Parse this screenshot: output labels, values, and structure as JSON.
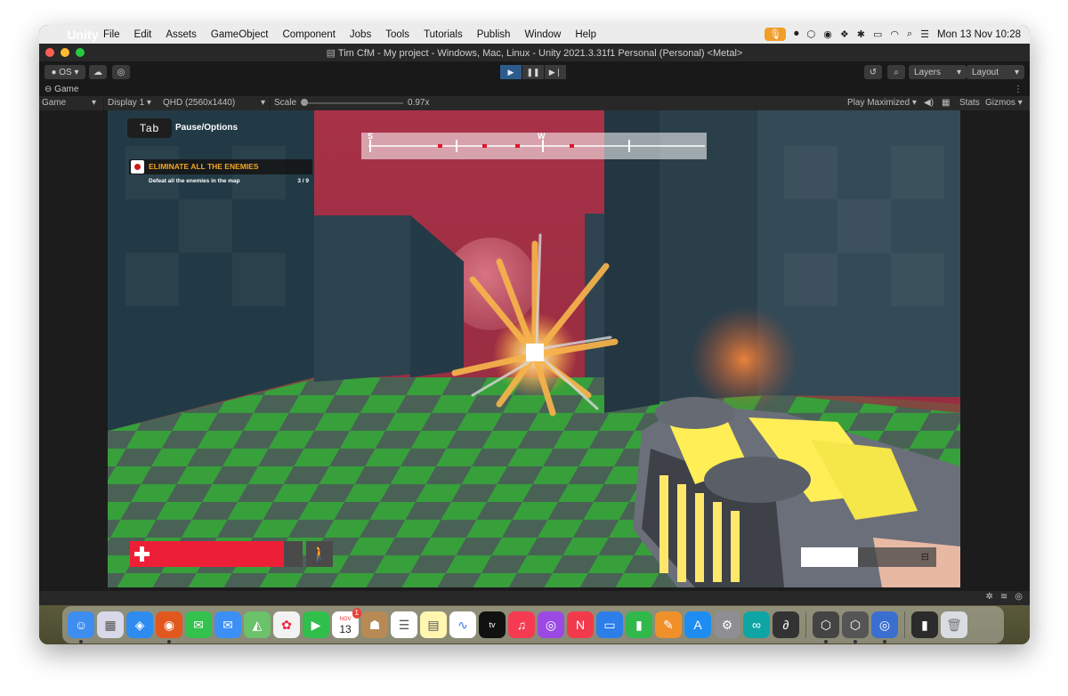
{
  "menubar": {
    "app_name": "Unity",
    "items": [
      "File",
      "Edit",
      "Assets",
      "GameObject",
      "Component",
      "Jobs",
      "Tools",
      "Tutorials",
      "Publish",
      "Window",
      "Help"
    ],
    "clock": "Mon 13 Nov  10:28"
  },
  "window": {
    "title": "Tim CfM - My project - Windows, Mac, Linux - Unity 2021.3.31f1 Personal (Personal) <Metal>"
  },
  "toolbar": {
    "account": "OS",
    "layers": "Layers",
    "layout": "Layout"
  },
  "game_tab": {
    "label": "Game"
  },
  "game_header": {
    "view_mode": "Game",
    "display": "Display 1",
    "resolution": "QHD (2560x1440)",
    "scale_label": "Scale",
    "scale_value": "0.97x",
    "play_mode": "Play Maximized",
    "stats": "Stats",
    "gizmos": "Gizmos"
  },
  "hud": {
    "tab_key": "Tab",
    "pause_label": "Pause/Options",
    "compass_s": "S",
    "compass_w": "W",
    "objective_title": "ELIMINATE ALL THE ENEMIES",
    "objective_desc": "Defeat all the enemies in the map",
    "objective_count": "3 / 9",
    "health_fraction": 0.89,
    "ammo_fraction": 0.42
  },
  "dock": {
    "calendar_month": "NOV",
    "calendar_day": "13",
    "calendar_badge": "1",
    "tv_label": "tv"
  },
  "colors": {
    "sky": "#9e3144",
    "health": "#ed1f36",
    "objective_title": "#f5a623",
    "play_active": "#2d5b8c"
  }
}
